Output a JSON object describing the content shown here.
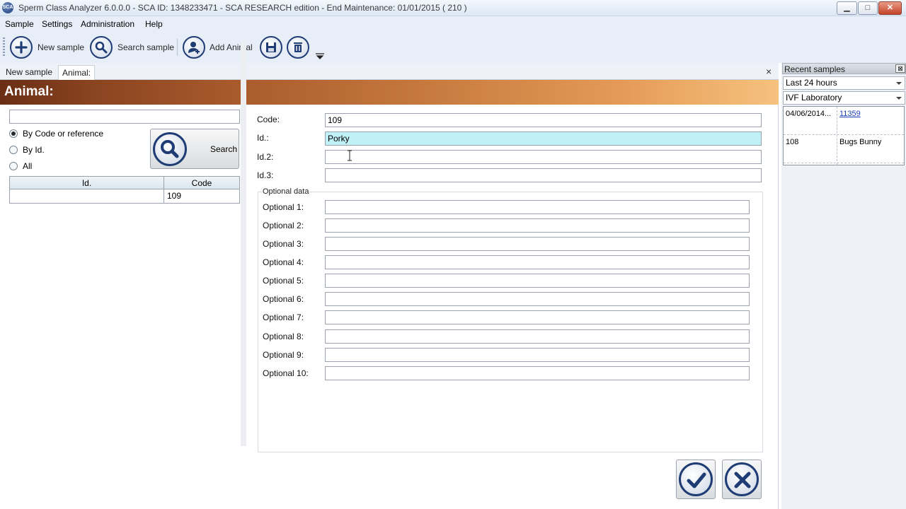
{
  "window": {
    "title": "Sperm Class Analyzer 6.0.0.0 - SCA ID: 1348233471 - SCA RESEARCH edition - End Maintenance: 01/01/2015 ( 210 )",
    "app_icon_text": "SCA",
    "min_glyph": "▁",
    "max_glyph": "□",
    "close_glyph": "✕"
  },
  "menu": [
    "Sample",
    "Settings",
    "Administration",
    "Help"
  ],
  "toolbar": {
    "new_sample": "New sample",
    "search_sample": "Search sample",
    "add_animal": "Add Animal"
  },
  "tabs": [
    {
      "label": "New sample",
      "active": false
    },
    {
      "label": "Animal:",
      "active": true
    }
  ],
  "tab_close_glyph": "×",
  "banner": {
    "title": "Animal:"
  },
  "left": {
    "search_value": "",
    "radios": [
      {
        "label": "By Code or reference",
        "checked": true
      },
      {
        "label": "By Id.",
        "checked": false
      },
      {
        "label": "All",
        "checked": false
      }
    ],
    "search_button": "Search",
    "grid": {
      "headers": [
        "Id.",
        "Code"
      ],
      "rows": [
        {
          "id": "",
          "code": "109"
        }
      ]
    }
  },
  "form": {
    "fields": [
      {
        "label": "Code:",
        "value": "109"
      },
      {
        "label": "Id.:",
        "value": "Porky"
      },
      {
        "label": "Id.2:",
        "value": ""
      },
      {
        "label": "Id.3:",
        "value": ""
      }
    ],
    "optional_group_title": "Optional data",
    "optional": [
      {
        "label": "Optional 1:",
        "value": ""
      },
      {
        "label": "Optional 2:",
        "value": ""
      },
      {
        "label": "Optional 3:",
        "value": ""
      },
      {
        "label": "Optional 4:",
        "value": ""
      },
      {
        "label": "Optional 5:",
        "value": ""
      },
      {
        "label": "Optional 6:",
        "value": ""
      },
      {
        "label": "Optional 7:",
        "value": ""
      },
      {
        "label": "Optional 8:",
        "value": ""
      },
      {
        "label": "Optional 9:",
        "value": ""
      },
      {
        "label": "Optional 10:",
        "value": ""
      }
    ]
  },
  "recent": {
    "title": "Recent samples",
    "pin_glyph": "⊠",
    "period": "Last 24 hours",
    "lab": "IVF Laboratory",
    "rows": [
      {
        "col1": "04/06/2014...",
        "col2": "11359",
        "link": true
      },
      {
        "col1": "108",
        "col2": "Bugs Bunny",
        "link": false
      }
    ]
  },
  "colors": {
    "highlight_field": "#bff1f6",
    "icon_blue": "#1f3c74",
    "banner_dark": "#6a2e14",
    "banner_light": "#f5c27e"
  }
}
